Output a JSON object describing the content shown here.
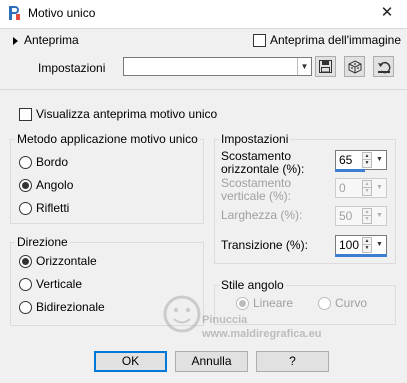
{
  "window": {
    "title": "Motivo unico",
    "close_glyph": "✕"
  },
  "preview": {
    "toggle_label": "Anteprima",
    "image_preview_label": "Anteprima dell'immagine",
    "image_preview_checked": false
  },
  "settings_row": {
    "label": "Impostazioni",
    "combo_value": "",
    "icons": [
      "save-icon",
      "cube-icon",
      "reset-icon"
    ]
  },
  "show_pattern_preview": {
    "label": "Visualizza anteprima motivo unico",
    "checked": false
  },
  "method_group": {
    "title": "Metodo applicazione motivo unico",
    "options": [
      "Bordo",
      "Angolo",
      "Rifletti"
    ],
    "selected": "Angolo"
  },
  "direction_group": {
    "title": "Direzione",
    "options": [
      "Orizzontale",
      "Verticale",
      "Bidirezionale"
    ],
    "selected": "Orizzontale"
  },
  "params_group": {
    "title": "Impostazioni",
    "horizontal_offset": {
      "label_line1": "Scostamento",
      "label_line2": "orizzontale (%):",
      "value": "65",
      "enabled": true
    },
    "vertical_offset": {
      "label_line1": "Scostamento",
      "label_line2": "verticale (%):",
      "value": "0",
      "enabled": false
    },
    "width": {
      "label": "Larghezza (%):",
      "value": "50",
      "enabled": false
    },
    "transition": {
      "label": "Transizione (%):",
      "value": "100",
      "enabled": true
    }
  },
  "corner_style_group": {
    "title": "Stile angolo",
    "options": [
      "Lineare",
      "Curvo"
    ],
    "selected": "Lineare",
    "enabled": false
  },
  "watermark": {
    "line1": "Pinuccia",
    "line2": "www.maldiregrafica.eu"
  },
  "buttons": {
    "ok": "OK",
    "cancel": "Annulla",
    "help": "?"
  },
  "colors": {
    "accent": "#0078d7",
    "slider": "#3c7fd1",
    "disabled_text": "#a0a0a0"
  }
}
